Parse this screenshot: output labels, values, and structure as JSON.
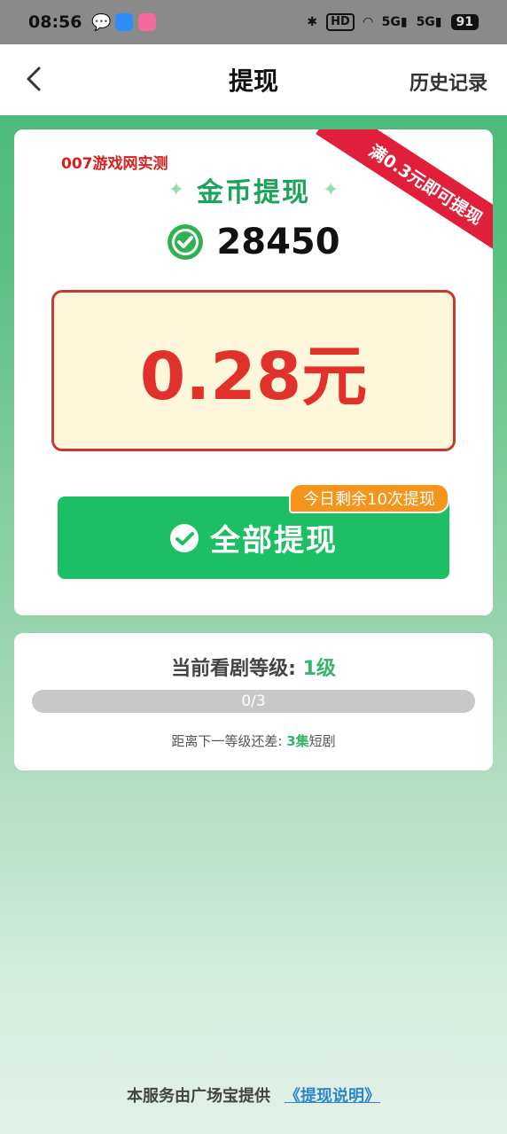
{
  "status_bar": {
    "time": "08:56",
    "hd": "HD",
    "signal_1": "5G",
    "signal_2": "5G",
    "battery": "91"
  },
  "header": {
    "title": "提现",
    "history_label": "历史记录"
  },
  "main_card": {
    "watermark": "007游戏网实测",
    "ribbon": "满0.3元即可提现",
    "coin_title": "金币提现",
    "coin_balance": "28450",
    "amount": "0.28元",
    "withdraw_button": "全部提现",
    "remaining_badge": "今日剩余10次提现"
  },
  "level_card": {
    "label": "当前看剧等级: ",
    "level": "1级",
    "progress_text": "0/3",
    "progress_fraction": 0,
    "next_prefix": "距离下一等级还差: ",
    "next_count": "3集",
    "next_suffix": "短剧"
  },
  "footer": {
    "provider_text": "本服务由广场宝提供",
    "link_text": "《提现说明》"
  },
  "colors": {
    "accent_green": "#1cbf63",
    "amount_red": "#e1312b",
    "badge_orange": "#f6951c",
    "ribbon_red": "#e0203a"
  }
}
